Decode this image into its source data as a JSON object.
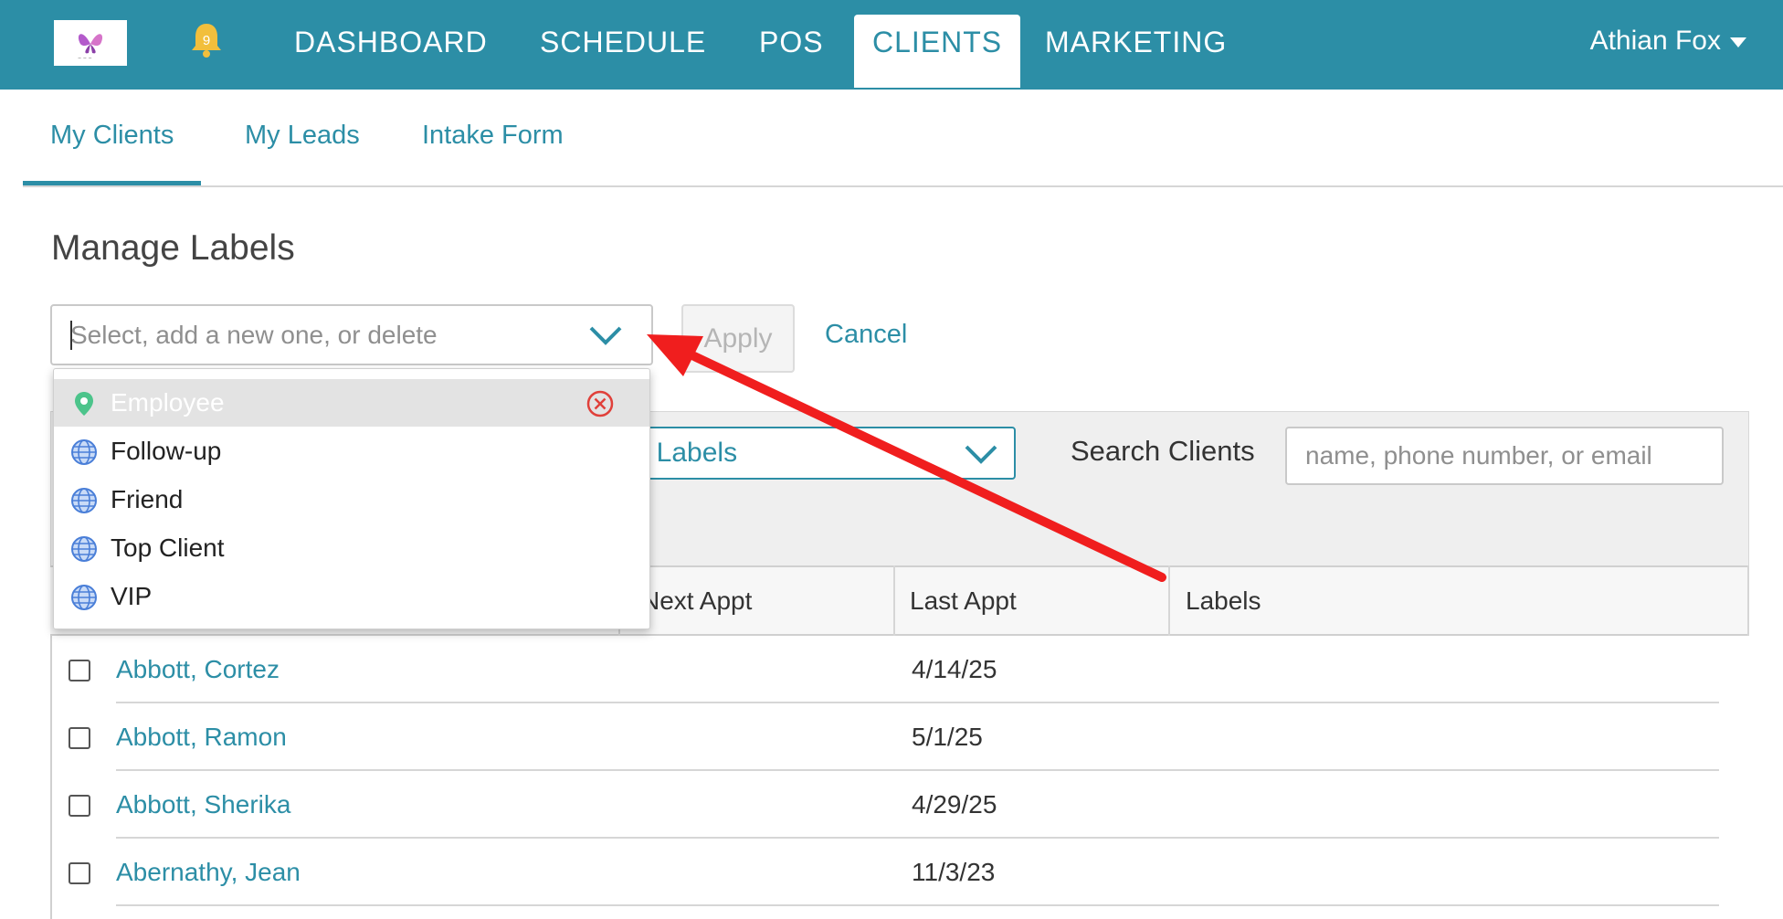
{
  "nav": {
    "notification_count": "9",
    "items": [
      {
        "label": "DASHBOARD"
      },
      {
        "label": "SCHEDULE"
      },
      {
        "label": "POS"
      },
      {
        "label": "CLIENTS"
      },
      {
        "label": "MARKETING"
      }
    ],
    "active": "CLIENTS",
    "user_name": "Athian Fox"
  },
  "subtabs": [
    {
      "label": "My Clients"
    },
    {
      "label": "My Leads"
    },
    {
      "label": "Intake Form"
    }
  ],
  "manage_labels": {
    "title": "Manage Labels",
    "select_placeholder": "Select, add a new one, or delete",
    "apply_label": "Apply",
    "cancel_label": "Cancel",
    "options": [
      {
        "label": "Employee",
        "icon": "location-pin-icon"
      },
      {
        "label": "Follow-up",
        "icon": "globe-icon"
      },
      {
        "label": "Friend",
        "icon": "globe-icon"
      },
      {
        "label": "Top Client",
        "icon": "globe-icon"
      },
      {
        "label": "VIP",
        "icon": "globe-icon"
      }
    ]
  },
  "filters": {
    "label_select_text": "ct Labels",
    "search_label": "Search Clients",
    "search_placeholder": "name, phone number, or email"
  },
  "table": {
    "headers": {
      "next_appt": "Next Appt",
      "last_appt": "Last Appt",
      "labels": "Labels"
    },
    "rows": [
      {
        "name": "Abbott, Cortez",
        "last_appt": "4/14/25"
      },
      {
        "name": "Abbott, Ramon",
        "last_appt": "5/1/25"
      },
      {
        "name": "Abbott, Sherika",
        "last_appt": "4/29/25"
      },
      {
        "name": "Abernathy, Jean",
        "last_appt": "11/3/23"
      }
    ]
  },
  "colors": {
    "brand": "#2c8ea6",
    "annotation_arrow": "#f01e1e",
    "delete": "#e0403a",
    "pin": "#4cc48b",
    "globe": "#4a7fd8"
  }
}
